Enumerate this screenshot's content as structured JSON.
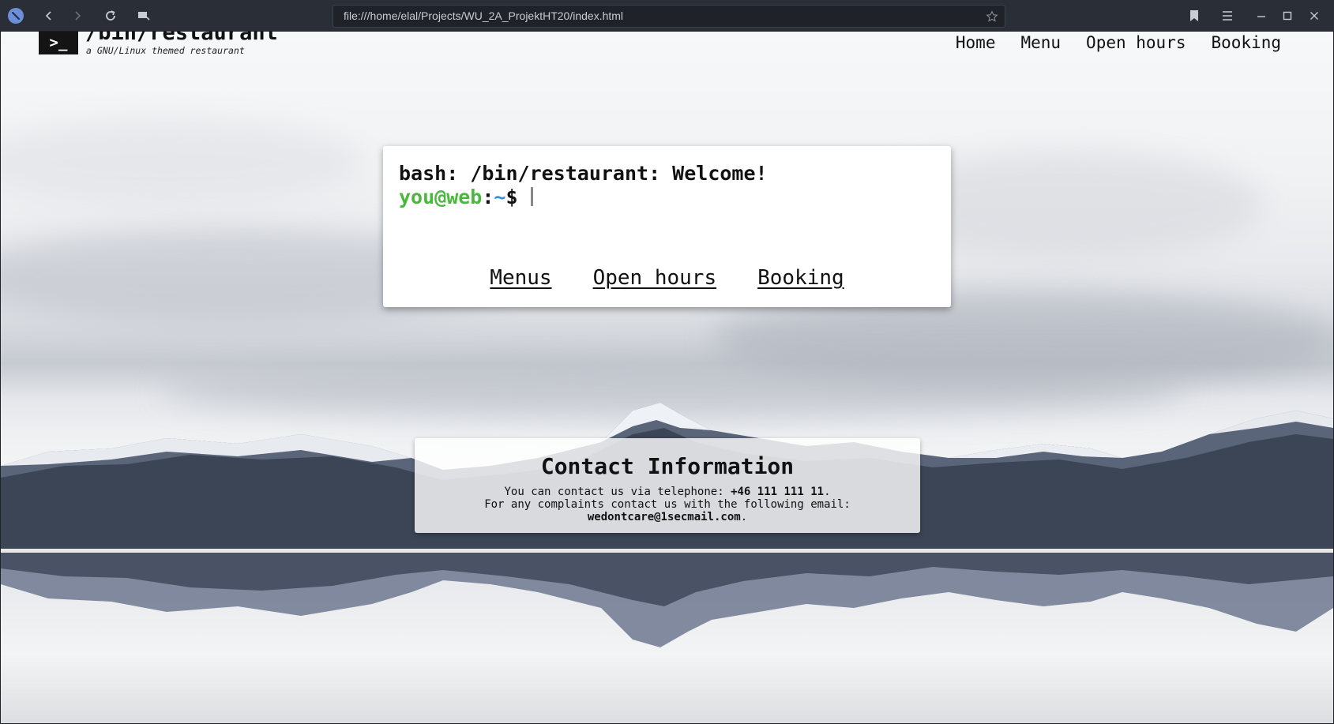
{
  "browser": {
    "url": "file:///home/elal/Projects/WU_2A_ProjektHT20/index.html",
    "icons": {
      "app": "app-menu-icon",
      "back": "back-arrow-icon",
      "forward": "forward-arrow-icon",
      "reload": "reload-icon",
      "tabs": "tab-overview-icon",
      "bookmark_star": "star-icon",
      "bookmarks": "bookmark-icon",
      "menu": "hamburger-menu-icon",
      "minimize": "minimize-icon",
      "maximize": "maximize-icon",
      "close": "close-icon"
    }
  },
  "site": {
    "logo_text": ">_",
    "title": "/bin/restaurant",
    "subtitle": "a GNU/Linux themed restaurant",
    "nav": [
      "Home",
      "Menu",
      "Open hours",
      "Booking"
    ]
  },
  "terminal": {
    "message": "bash: /bin/restaurant: Welcome!",
    "prompt_user": "you@web",
    "prompt_sep": ":",
    "prompt_tilde": "~",
    "prompt_dollar": "$",
    "links": [
      "Menus",
      "Open hours",
      "Booking"
    ],
    "colors": {
      "user": "#4ab83c",
      "tilde": "#3a8fd6"
    }
  },
  "contact": {
    "heading": "Contact Information",
    "line1_prefix": "You can contact us via telephone: ",
    "phone": "+46 111 111 11",
    "line1_suffix": ".",
    "line2": "For any complaints contact us with the following email:",
    "email": "wedontcare@1secmail.com",
    "line3_suffix": "."
  }
}
